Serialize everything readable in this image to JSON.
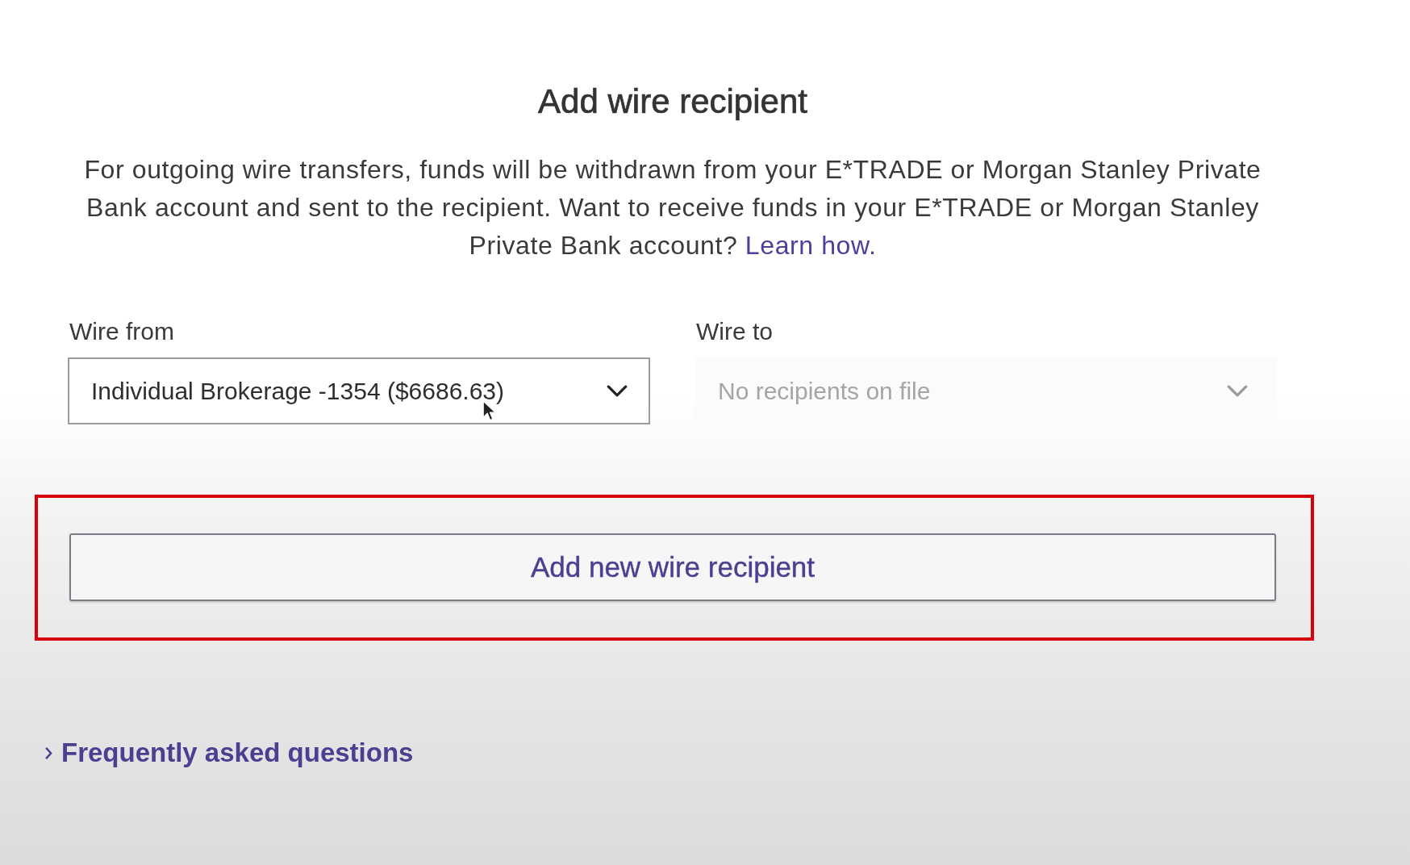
{
  "title": "Add wire recipient",
  "intro": {
    "text": "For outgoing wire transfers, funds will be withdrawn from your E*TRADE or Morgan Stanley Private Bank account and sent to the recipient. Want to receive funds in your E*TRADE or Morgan Stanley Private Bank account?",
    "link": "Learn how."
  },
  "fields": [
    {
      "label": "Wire from",
      "value": "Individual Brokerage -1354 ($6686.63)",
      "disabled": false
    },
    {
      "label": "Wire to",
      "value": "No recipients on file",
      "disabled": true
    }
  ],
  "add_button": {
    "label": "Add new wire recipient",
    "highlighted": true
  },
  "faq": {
    "label": "Frequently asked questions",
    "expanded": false
  }
}
